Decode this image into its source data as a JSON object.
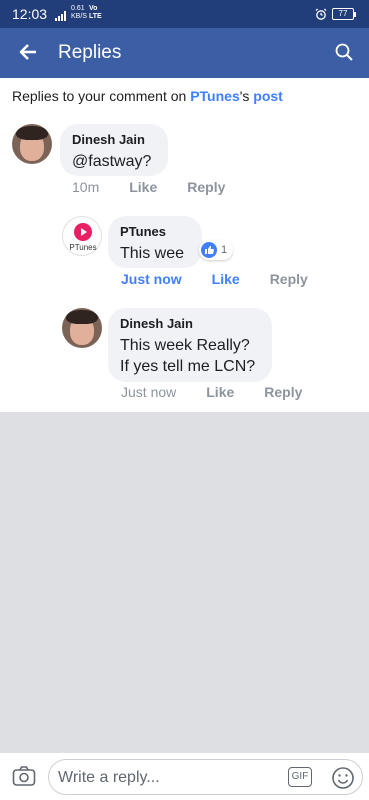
{
  "status_bar": {
    "time": "12:03",
    "net_speed": "0.61",
    "net_unit": "KB/S",
    "lte_vo": "Vo",
    "lte": "LTE",
    "battery": "77"
  },
  "header": {
    "title": "Replies",
    "back_icon": "arrow-left-icon",
    "search_icon": "search-icon"
  },
  "context": {
    "prefix": "Replies to your comment on ",
    "page_link": "PTunes",
    "possessive": "'s ",
    "post_link": "post"
  },
  "comments": [
    {
      "author": "Dinesh Jain",
      "text": "@fastway?",
      "time": "10m",
      "like": "Like",
      "reply": "Reply"
    },
    {
      "author": "PTunes",
      "text": "This wee",
      "time": "Just now",
      "like": "Like",
      "reply": "Reply",
      "reaction_count": "1",
      "avatar_label": "PTunes"
    },
    {
      "author": "Dinesh Jain",
      "text_line1": "This week Really?",
      "text_line2": "If yes tell me LCN?",
      "time": "Just now",
      "like": "Like",
      "reply": "Reply"
    }
  ],
  "composer": {
    "placeholder": "Write a reply...",
    "gif_label": "GIF"
  },
  "colors": {
    "status_bar": "#223e7a",
    "header": "#3b5ea4",
    "link": "#4080ff",
    "brand_pink": "#e91e63"
  }
}
